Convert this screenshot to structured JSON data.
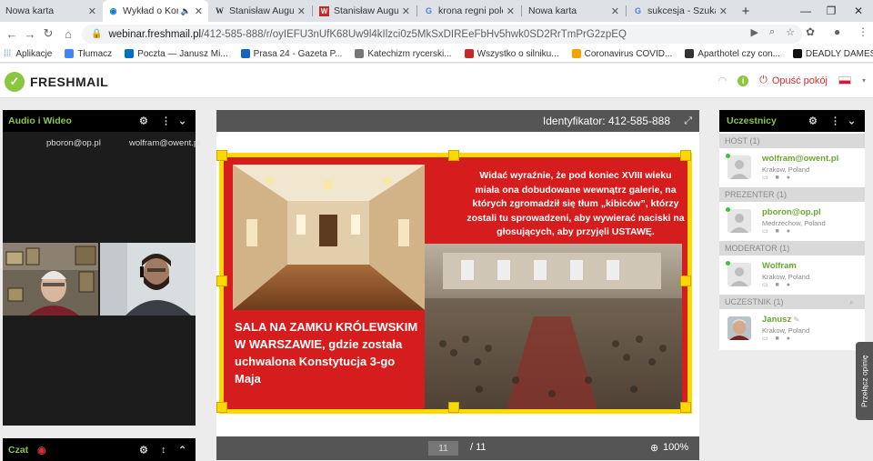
{
  "browser": {
    "tabs": [
      {
        "label": "Nowa karta",
        "icon": "blank-page-icon"
      },
      {
        "label": "Wykład o Kon",
        "icon": "freshmail-icon",
        "active": true
      },
      {
        "label": "Stanisław August P",
        "icon": "wikipedia-icon"
      },
      {
        "label": "Stanisław August P",
        "icon": "red-w-icon"
      },
      {
        "label": "krona regni polon",
        "icon": "google-icon"
      },
      {
        "label": "Nowa karta",
        "icon": "blank-page-icon"
      },
      {
        "label": "sukcesja - Szukaj w",
        "icon": "google-icon"
      }
    ],
    "url_host": "webinar.freshmail.pl",
    "url_path": "/412-585-888/r/oyIEFU3nUfK68Uw9l4kIlzci0z5MkSxDIREeFbHv5hwk0SD2RrTmPrG2zpEQ",
    "bookmarks": [
      {
        "label": "Aplikacje",
        "color": "#4285f4"
      },
      {
        "label": "Tłumacz",
        "color": "#4285f4"
      },
      {
        "label": "Poczta — Janusz Mi...",
        "color": "#0072c6"
      },
      {
        "label": "Prasa 24 - Gazeta P...",
        "color": "#1565c0"
      },
      {
        "label": "Katechizm rycerski...",
        "color": "#555555"
      },
      {
        "label": "Wszystko o silniku...",
        "color": "#c62828"
      },
      {
        "label": "Coronavirus COVID...",
        "color": "#f4a300"
      },
      {
        "label": "Aparthotel czy con...",
        "color": "#333333"
      },
      {
        "label": "DEADLY DAMES - G...",
        "color": "#111111"
      }
    ]
  },
  "app": {
    "brand": "FRESHMAIL",
    "brand_color": "#8cc63f",
    "leave_label": "Opuść pokój",
    "accent_red": "#d32f2f"
  },
  "left_panel": {
    "title": "Audio i Wideo",
    "video_users": [
      "pboron@op.pl",
      "wolfram@owent.pl"
    ],
    "chat_title": "Czat"
  },
  "presentation": {
    "identifier": "Identyfikator: 412-585-888",
    "slide": {
      "top_text": "Widać wyraźnie, że pod koniec XVIII wieku miała ona dobudowane wewnątrz galerie, na których zgromadził się tłum „kibiców”, którzy zostali tu sprowadzeni, aby wywierać naciski na głosujących, aby przyjęli USTAWĘ.",
      "bottom_text": "SALA NA ZAMKU KRÓLEWSKIM W WARSZAWIE, gdzie została uchwalona Konstytucja 3-go Maja"
    },
    "page_current": "11",
    "page_total": "/ 11",
    "zoom": "100%"
  },
  "participants": {
    "title": "Uczestnicy",
    "side_tab": "Przełącz opinię",
    "sections": [
      {
        "label": "HOST",
        "count": "(1)",
        "user": {
          "name": "wolfram@owent.pl",
          "location": "Krakow, Poland"
        }
      },
      {
        "label": "PREZENTER",
        "count": "(1)",
        "user": {
          "name": "pboron@op.pl",
          "location": "Medrzechow, Poland"
        }
      },
      {
        "label": "MODERATOR",
        "count": "(1)",
        "user": {
          "name": "Wolfram",
          "location": "Krakow, Poland"
        }
      },
      {
        "label": "UCZESTNIK",
        "count": "(1)",
        "user": {
          "name": "Janusz",
          "location": "Krakow, Poland"
        }
      }
    ]
  }
}
